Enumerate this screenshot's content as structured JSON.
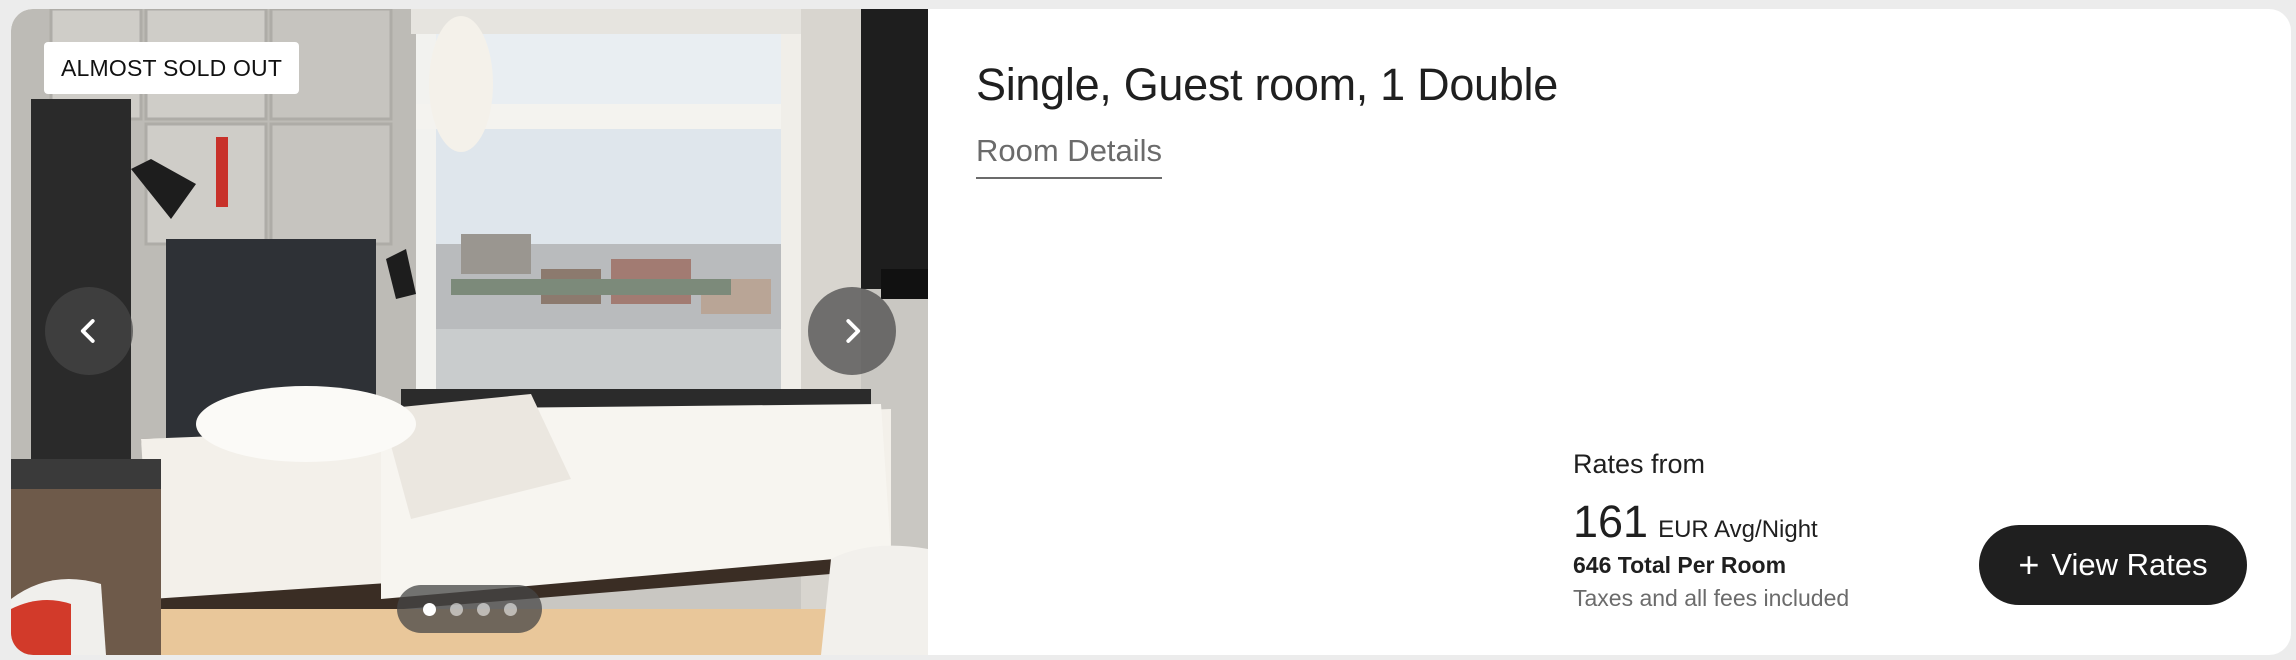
{
  "room": {
    "badge": "ALMOST SOLD OUT",
    "title": "Single, Guest room, 1 Double",
    "details_link": "Room Details"
  },
  "gallery": {
    "prev_icon": "chevron-left-icon",
    "next_icon": "chevron-right-icon",
    "slide_count": 4,
    "active_slide": 1
  },
  "rates": {
    "label": "Rates from",
    "price": "161",
    "per_night": "EUR Avg/Night",
    "total": "646 Total Per Room",
    "taxes": "Taxes and all fees included",
    "button_plus": "+",
    "button_label": "View Rates"
  },
  "colors": {
    "button_bg": "#1f1f1f",
    "muted_text": "#6b6b6b"
  }
}
